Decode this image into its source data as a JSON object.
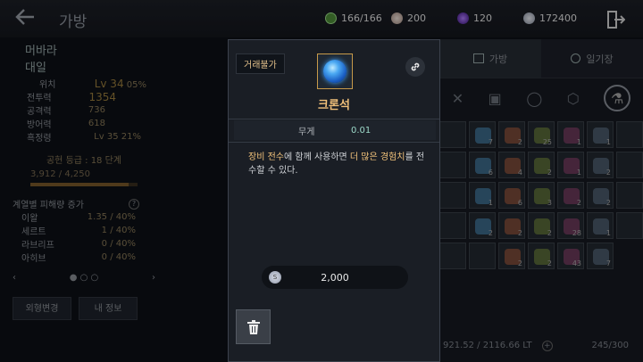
{
  "header": {
    "back_icon": "arrow-left-icon",
    "title": "가방",
    "currencies": [
      {
        "icon": "energy-icon",
        "value": "166/166",
        "color": "#6bd36b"
      },
      {
        "icon": "pearl-icon",
        "value": "200",
        "color": "#d9c4b8"
      },
      {
        "icon": "gem-icon",
        "value": "120",
        "color": "#7b3fd6"
      },
      {
        "icon": "silver-coin-icon",
        "value": "172400",
        "color": "#c8ccd6"
      }
    ],
    "exit_icon": "exit-door-icon"
  },
  "character": {
    "class_name": "머바라",
    "character_name": "대일",
    "stats": [
      {
        "label": "위치",
        "value": "Lv 34",
        "extra": "05%"
      },
      {
        "label": "전투력",
        "value": "1354"
      },
      {
        "label": "공격력",
        "value": "736"
      },
      {
        "label": "방어력",
        "value": "618"
      },
      {
        "label": "흑정령",
        "value": "Lv 35",
        "extra": "21%"
      }
    ],
    "contribution_label": "공헌 등급 : 18 단계",
    "contribution_value": "3,912 / 4,250",
    "contribution_progress": 0.92,
    "damage_title": "계열별 피해량 증가",
    "damage_help": "?",
    "damage_rows": [
      {
        "label": "이왈",
        "value": "1.35 / 40%"
      },
      {
        "label": "세르트",
        "value": "1 / 40%"
      },
      {
        "label": "라브리프",
        "value": "0 / 40%"
      },
      {
        "label": "아히브",
        "value": "0 / 40%"
      }
    ],
    "buttons": {
      "appearance": "외형변경",
      "my_info": "내 정보"
    }
  },
  "bag": {
    "tabs": [
      {
        "label": "가방",
        "icon": "bag-icon"
      },
      {
        "label": "일기장",
        "icon": "diary-icon"
      }
    ],
    "categories": [
      "sword-icon",
      "armor-icon",
      "ring-icon",
      "potion-icon",
      "crystal-icon"
    ],
    "slots": [
      {
        "icon": "empty-slot",
        "qty": ""
      },
      {
        "icon": "potion-bottle-icon",
        "qty": "7"
      },
      {
        "icon": "blue-orb-icon",
        "qty": "2"
      },
      {
        "icon": "scroll-icon",
        "qty": "25"
      },
      {
        "icon": "note-icon",
        "qty": "1"
      },
      {
        "icon": "tools-icon",
        "qty": "1"
      },
      {
        "icon": "empty-slot",
        "qty": ""
      },
      {
        "icon": "empty-slot",
        "qty": ""
      },
      {
        "icon": "herb-icon",
        "qty": "6"
      },
      {
        "icon": "mushroom-icon",
        "qty": "4"
      },
      {
        "icon": "seed-icon",
        "qty": "2"
      },
      {
        "icon": "meat-icon",
        "qty": "1"
      },
      {
        "icon": "ore-icon",
        "qty": "2"
      },
      {
        "icon": "empty-slot",
        "qty": ""
      },
      {
        "icon": "empty-slot",
        "qty": ""
      },
      {
        "icon": "feather-icon",
        "qty": "1"
      },
      {
        "icon": "beads-icon",
        "qty": "6"
      },
      {
        "icon": "book-icon",
        "qty": "3"
      },
      {
        "icon": "bowl-icon",
        "qty": "2"
      },
      {
        "icon": "flask-icon",
        "qty": "2"
      },
      {
        "icon": "empty-slot",
        "qty": ""
      },
      {
        "icon": "empty-slot",
        "qty": ""
      },
      {
        "icon": "egg-icon",
        "qty": "2"
      },
      {
        "icon": "stone-icon",
        "qty": "2"
      },
      {
        "icon": "gear-icon",
        "qty": "2"
      },
      {
        "icon": "potion-red-icon",
        "qty": "28"
      },
      {
        "icon": "fish-icon",
        "qty": "1"
      },
      {
        "icon": "empty-slot",
        "qty": ""
      },
      {
        "icon": "empty-slot",
        "qty": ""
      },
      {
        "icon": "empty-slot",
        "qty": ""
      },
      {
        "icon": "bottle-icon",
        "qty": "2"
      },
      {
        "icon": "leaf-icon",
        "qty": "2"
      },
      {
        "icon": "sack-icon",
        "qty": "43"
      },
      {
        "icon": "corn-icon",
        "qty": "7"
      }
    ],
    "weight": "921.52 / 2116.66 LT",
    "add_icon": "plus-icon",
    "capacity": "245/300"
  },
  "tooltip": {
    "trade_badge": "거래불가",
    "item_icon": "blue-orb-icon",
    "link_icon": "link-icon",
    "item_name": "크론석",
    "weight_label": "무게",
    "weight_value": "0.01",
    "desc_hl1": "장비 전수",
    "desc_mid": "에 함께 사용하면 ",
    "desc_hl2": "더 많은 경험치",
    "desc_tail": "를 전수할 수 있다.",
    "price": "2,000",
    "price_icon": "silver-coin-icon",
    "trash_icon": "trash-icon",
    "colors": {
      "highlight": "#f1c27a",
      "item_name": "#f0c07a",
      "weight_value": "#9cd8c8"
    }
  }
}
